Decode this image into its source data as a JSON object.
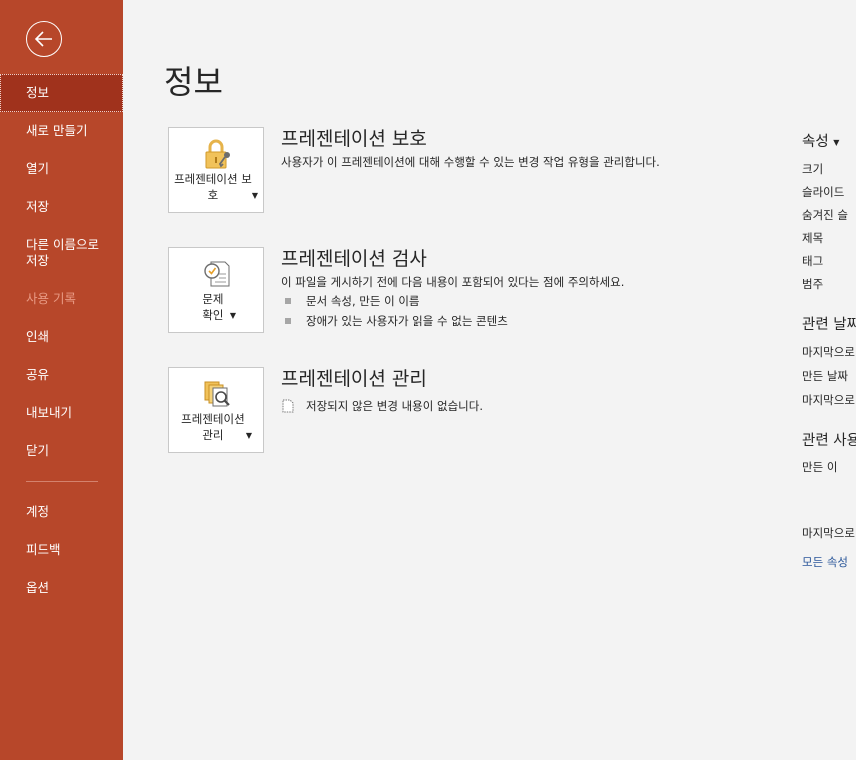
{
  "sidebar": {
    "items": [
      {
        "label": "정보"
      },
      {
        "label": "새로 만들기"
      },
      {
        "label": "열기"
      },
      {
        "label": "저장"
      },
      {
        "label": "다른 이름으로 저장"
      },
      {
        "label": "사용 기록"
      },
      {
        "label": "인쇄"
      },
      {
        "label": "공유"
      },
      {
        "label": "내보내기"
      },
      {
        "label": "닫기"
      }
    ],
    "bottom_items": [
      {
        "label": "계정"
      },
      {
        "label": "피드백"
      },
      {
        "label": "옵션"
      }
    ]
  },
  "main": {
    "title": "정보",
    "protect": {
      "button_label": "프레젠테이션 보호",
      "heading": "프레젠테이션 보호",
      "description": "사용자가 이 프레젠테이션에 대해 수행할 수 있는 변경 작업 유형을 관리합니다."
    },
    "inspect": {
      "button_label": "문제 확인",
      "heading": "프레젠테이션 검사",
      "description": "이 파일을 게시하기 전에 다음 내용이 포함되어 있다는 점에 주의하세요.",
      "bullets": [
        "문서 속성, 만든 이 이름",
        "장애가 있는 사용자가 읽을 수 없는 콘텐츠"
      ]
    },
    "manage": {
      "button_label": "프레젠테이션 관리",
      "heading": "프레젠테이션 관리",
      "note": "저장되지 않은 변경 내용이 없습니다."
    }
  },
  "properties": {
    "heading": "속성",
    "rows": [
      "크기",
      "슬라이드",
      "숨겨진 슬",
      "제목",
      "태그",
      "범주"
    ],
    "dates_heading": "관련 날짜",
    "date_rows": [
      "마지막으로",
      "만든 날짜",
      "마지막으로"
    ],
    "people_heading": "관련 사용",
    "people_rows": [
      "만든 이",
      "마지막으로"
    ],
    "all_link": "모든 속성"
  },
  "colors": {
    "sidebar_bg": "#b7472a",
    "sidebar_active": "#a0321c",
    "link": "#2b579a"
  }
}
